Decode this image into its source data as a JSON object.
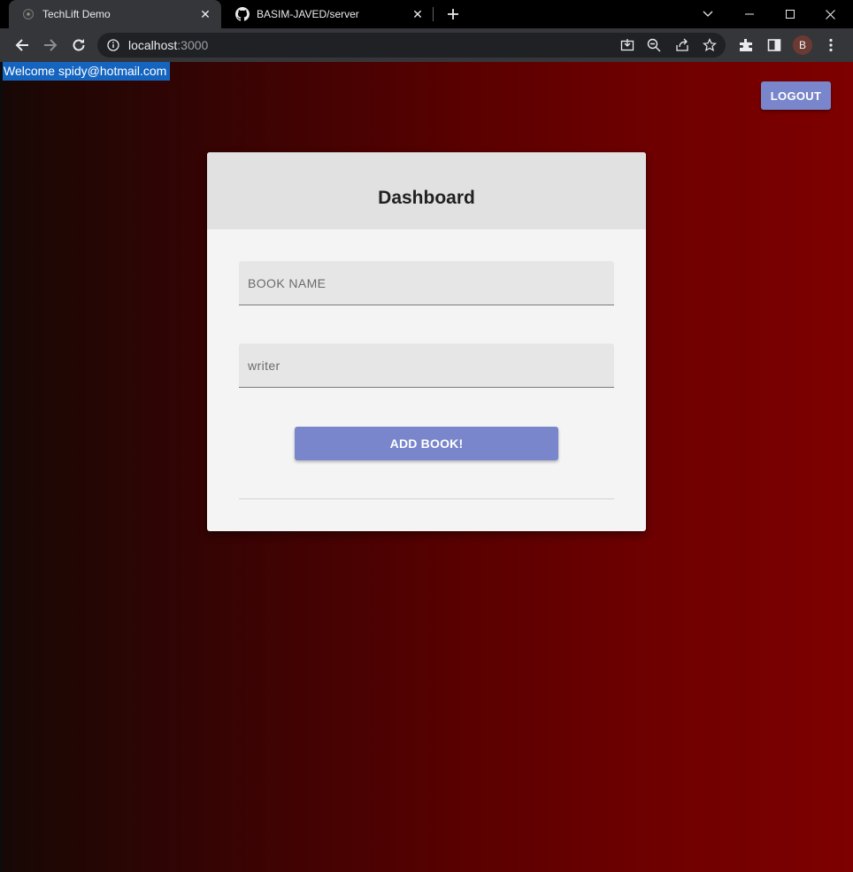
{
  "browser": {
    "tabs": [
      {
        "title": "TechLift Demo",
        "active": true,
        "favicon": "site-favicon-icon"
      },
      {
        "title": "BASIM-JAVED/server",
        "active": false,
        "favicon": "github-icon"
      }
    ],
    "url": {
      "host": "localhost",
      "port": ":3000"
    },
    "profile_initial": "B"
  },
  "page": {
    "welcome_text": "Welcome spidy@hotmail.com",
    "logout_label": "LOGOUT",
    "dashboard": {
      "title": "Dashboard",
      "book_name_placeholder": "BOOK NAME",
      "writer_placeholder": "writer",
      "add_button_label": "ADD BOOK!"
    }
  },
  "colors": {
    "accent_button": "#7986cb",
    "welcome_badge": "#1565c0",
    "background_gradient_end": "#7e0000"
  }
}
